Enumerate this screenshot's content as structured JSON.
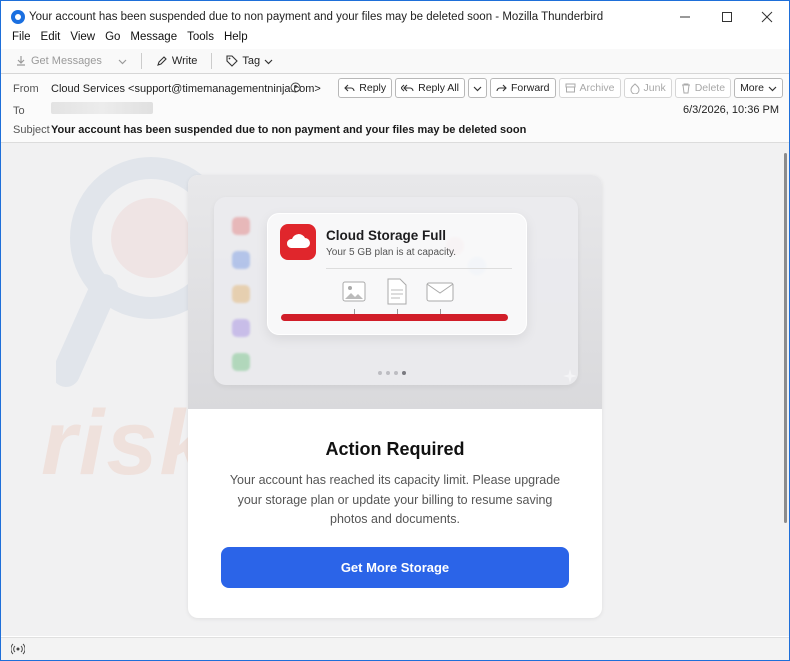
{
  "window": {
    "title": "Your account has been suspended due to non payment and your files may be deleted soon - Mozilla Thunderbird",
    "icon": "thunderbird-icon",
    "minimize": "—",
    "maximize": "☐",
    "close": "✕"
  },
  "menu": [
    "File",
    "Edit",
    "View",
    "Go",
    "Message",
    "Tools",
    "Help"
  ],
  "toolbar": {
    "get_messages": "Get Messages",
    "write": "Write",
    "tag": "Tag"
  },
  "header": {
    "from_label": "From",
    "from_value": "Cloud Services <support@timemanagementninja.com>",
    "to_label": "To",
    "subject_label": "Subject",
    "subject_value": "Your account has been suspended due to non payment and your files may be deleted soon",
    "date": "6/3/2026, 10:36 PM",
    "buttons": {
      "reply": "Reply",
      "reply_all": "Reply All",
      "forward": "Forward",
      "archive": "Archive",
      "junk": "Junk",
      "delete": "Delete",
      "more": "More"
    }
  },
  "email": {
    "notification_title": "Cloud Storage Full",
    "notification_sub": "Your 5 GB plan is at capacity.",
    "storage_used": 1.0,
    "heading": "Action Required",
    "body": "Your account has reached its capacity limit. Please upgrade your storage plan or update your billing to resume saving photos and documents.",
    "cta": "Get More Storage"
  },
  "watermark": "risk.com",
  "colors": {
    "accent": "#2b64e8",
    "alert_red": "#d11e29",
    "window_border": "#1e6fd9"
  }
}
